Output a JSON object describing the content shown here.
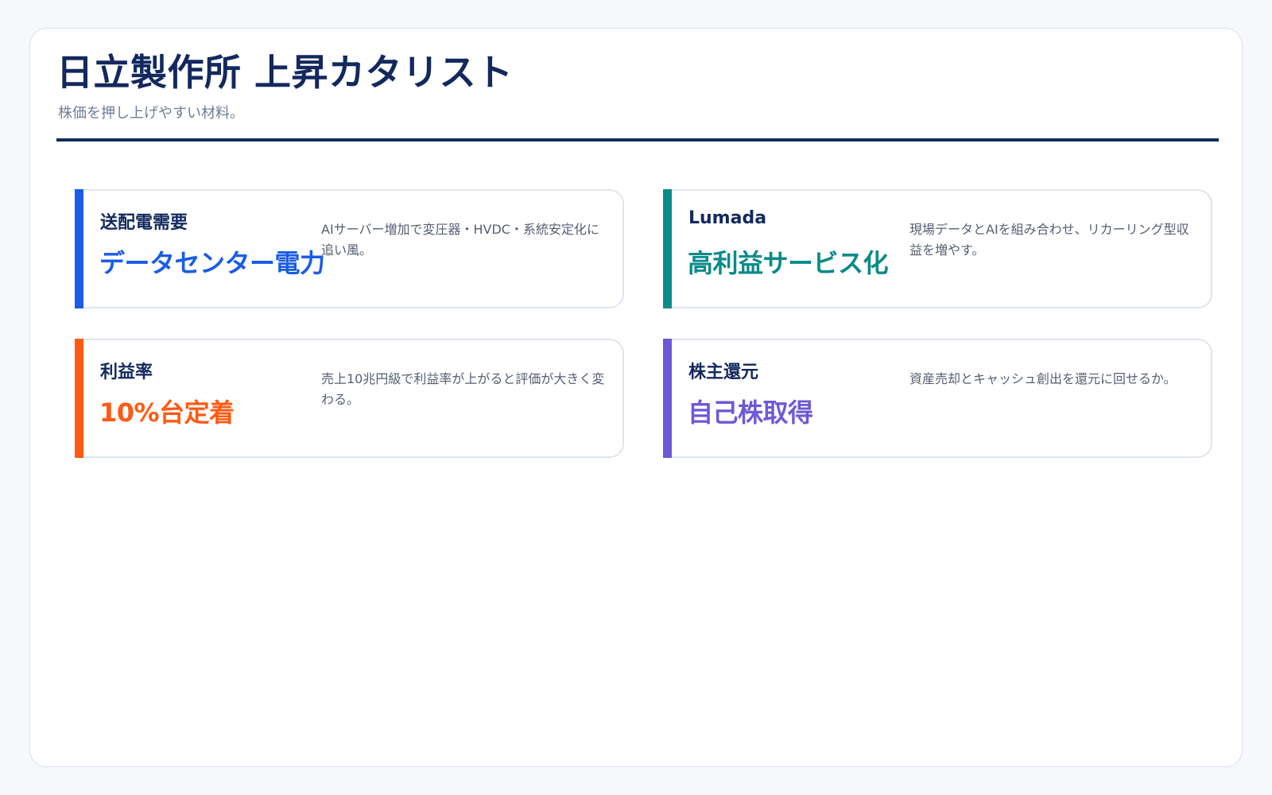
{
  "header": {
    "title": "日立製作所 上昇カタリスト",
    "subtitle": "株価を押し上げやすい材料。"
  },
  "colors": {
    "navy": "#13295e",
    "blue": "#1a5ce6",
    "teal": "#0b8a8a",
    "orange": "#ff5a14",
    "purple": "#6f58d6"
  },
  "cards": [
    {
      "label": "送配電需要",
      "headline": "データセンター電力",
      "description": "AIサーバー増加で変圧器・HVDC・系統安定化に追い風。",
      "accent": "#1a5ce6"
    },
    {
      "label": "Lumada",
      "headline": "高利益サービス化",
      "description": "現場データとAIを組み合わせ、リカーリング型収益を増やす。",
      "accent": "#0b8a8a"
    },
    {
      "label": "利益率",
      "headline": "10%台定着",
      "description": "売上10兆円級で利益率が上がると評価が大きく変わる。",
      "accent": "#ff5a14"
    },
    {
      "label": "株主還元",
      "headline": "自己株取得",
      "description": "資産売却とキャッシュ創出を還元に回せるか。",
      "accent": "#6f58d6"
    }
  ]
}
